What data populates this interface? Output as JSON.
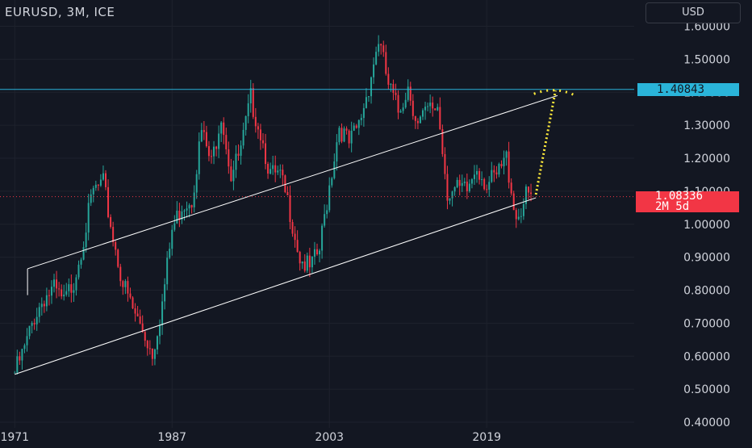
{
  "header": {
    "title": "EURUSD, 3M, ICE",
    "currency_button": "USD"
  },
  "price_tags": {
    "resistance": "1.40843",
    "last_price": "1.08336",
    "countdown": "2M 5d"
  },
  "colors": {
    "background": "#131722",
    "up": "#26a69a",
    "down": "#f23645",
    "grid": "#1e222d",
    "channel": "#ffffff",
    "resistance_line": "#2ab4d9",
    "projection": "#ffeb3b",
    "axis_text": "#d1d4dc"
  },
  "chart_data": {
    "type": "candlestick",
    "title": "EURUSD, 3M, ICE",
    "x_ticks": [
      "1971",
      "1987",
      "2003",
      "2019"
    ],
    "y_ticks": [
      "1.60000",
      "1.50000",
      "1.40000",
      "1.30000",
      "1.20000",
      "1.10000",
      "1.00000",
      "0.90000",
      "0.80000",
      "0.70000",
      "0.60000",
      "0.50000",
      "0.40000"
    ],
    "xlim": [
      1969.5,
      2034.0
    ],
    "ylim": [
      0.38,
      1.63
    ],
    "grid": true,
    "close_path": [
      [
        1971.0,
        0.55
      ],
      [
        1972.0,
        0.62
      ],
      [
        1973.0,
        0.72
      ],
      [
        1974.0,
        0.78
      ],
      [
        1975.0,
        0.8
      ],
      [
        1976.0,
        0.76
      ],
      [
        1977.0,
        0.83
      ],
      [
        1978.0,
        0.96
      ],
      [
        1979.0,
        1.1
      ],
      [
        1980.0,
        1.12
      ],
      [
        1981.0,
        0.96
      ],
      [
        1982.0,
        0.82
      ],
      [
        1983.0,
        0.74
      ],
      [
        1984.0,
        0.68
      ],
      [
        1985.0,
        0.61
      ],
      [
        1986.0,
        0.76
      ],
      [
        1987.0,
        0.98
      ],
      [
        1988.0,
        1.06
      ],
      [
        1989.0,
        1.08
      ],
      [
        1990.0,
        1.28
      ],
      [
        1991.0,
        1.18
      ],
      [
        1992.0,
        1.34
      ],
      [
        1993.0,
        1.15
      ],
      [
        1994.0,
        1.22
      ],
      [
        1995.0,
        1.38
      ],
      [
        1996.0,
        1.28
      ],
      [
        1997.0,
        1.15
      ],
      [
        1998.0,
        1.14
      ],
      [
        1999.0,
        1.04
      ],
      [
        2000.0,
        0.9
      ],
      [
        2001.0,
        0.86
      ],
      [
        2002.0,
        0.92
      ],
      [
        2003.0,
        1.12
      ],
      [
        2004.0,
        1.3
      ],
      [
        2005.0,
        1.24
      ],
      [
        2006.0,
        1.3
      ],
      [
        2007.0,
        1.42
      ],
      [
        2008.0,
        1.56
      ],
      [
        2009.0,
        1.42
      ],
      [
        2010.0,
        1.34
      ],
      [
        2011.0,
        1.42
      ],
      [
        2012.0,
        1.3
      ],
      [
        2013.0,
        1.34
      ],
      [
        2014.0,
        1.36
      ],
      [
        2015.0,
        1.1
      ],
      [
        2016.0,
        1.1
      ],
      [
        2017.0,
        1.1
      ],
      [
        2018.0,
        1.18
      ],
      [
        2019.0,
        1.12
      ],
      [
        2020.0,
        1.14
      ],
      [
        2021.0,
        1.2
      ],
      [
        2022.0,
        1.02
      ],
      [
        2023.0,
        1.08
      ],
      [
        2023.7,
        1.08336
      ]
    ],
    "channel": {
      "upper": [
        [
          1972.3,
          0.865
        ],
        [
          2026.2,
          1.39
        ]
      ],
      "lower": [
        [
          1971.0,
          0.545
        ],
        [
          2024.0,
          1.08
        ]
      ]
    },
    "resistance_level": 1.40843,
    "last_price": 1.08336,
    "projection": {
      "path": [
        [
          2024.0,
          1.09
        ],
        [
          2026.0,
          1.405
        ]
      ],
      "arc_left": [
        2023.8,
        1.395
      ],
      "arc_right": [
        2028.0,
        1.39
      ]
    }
  }
}
